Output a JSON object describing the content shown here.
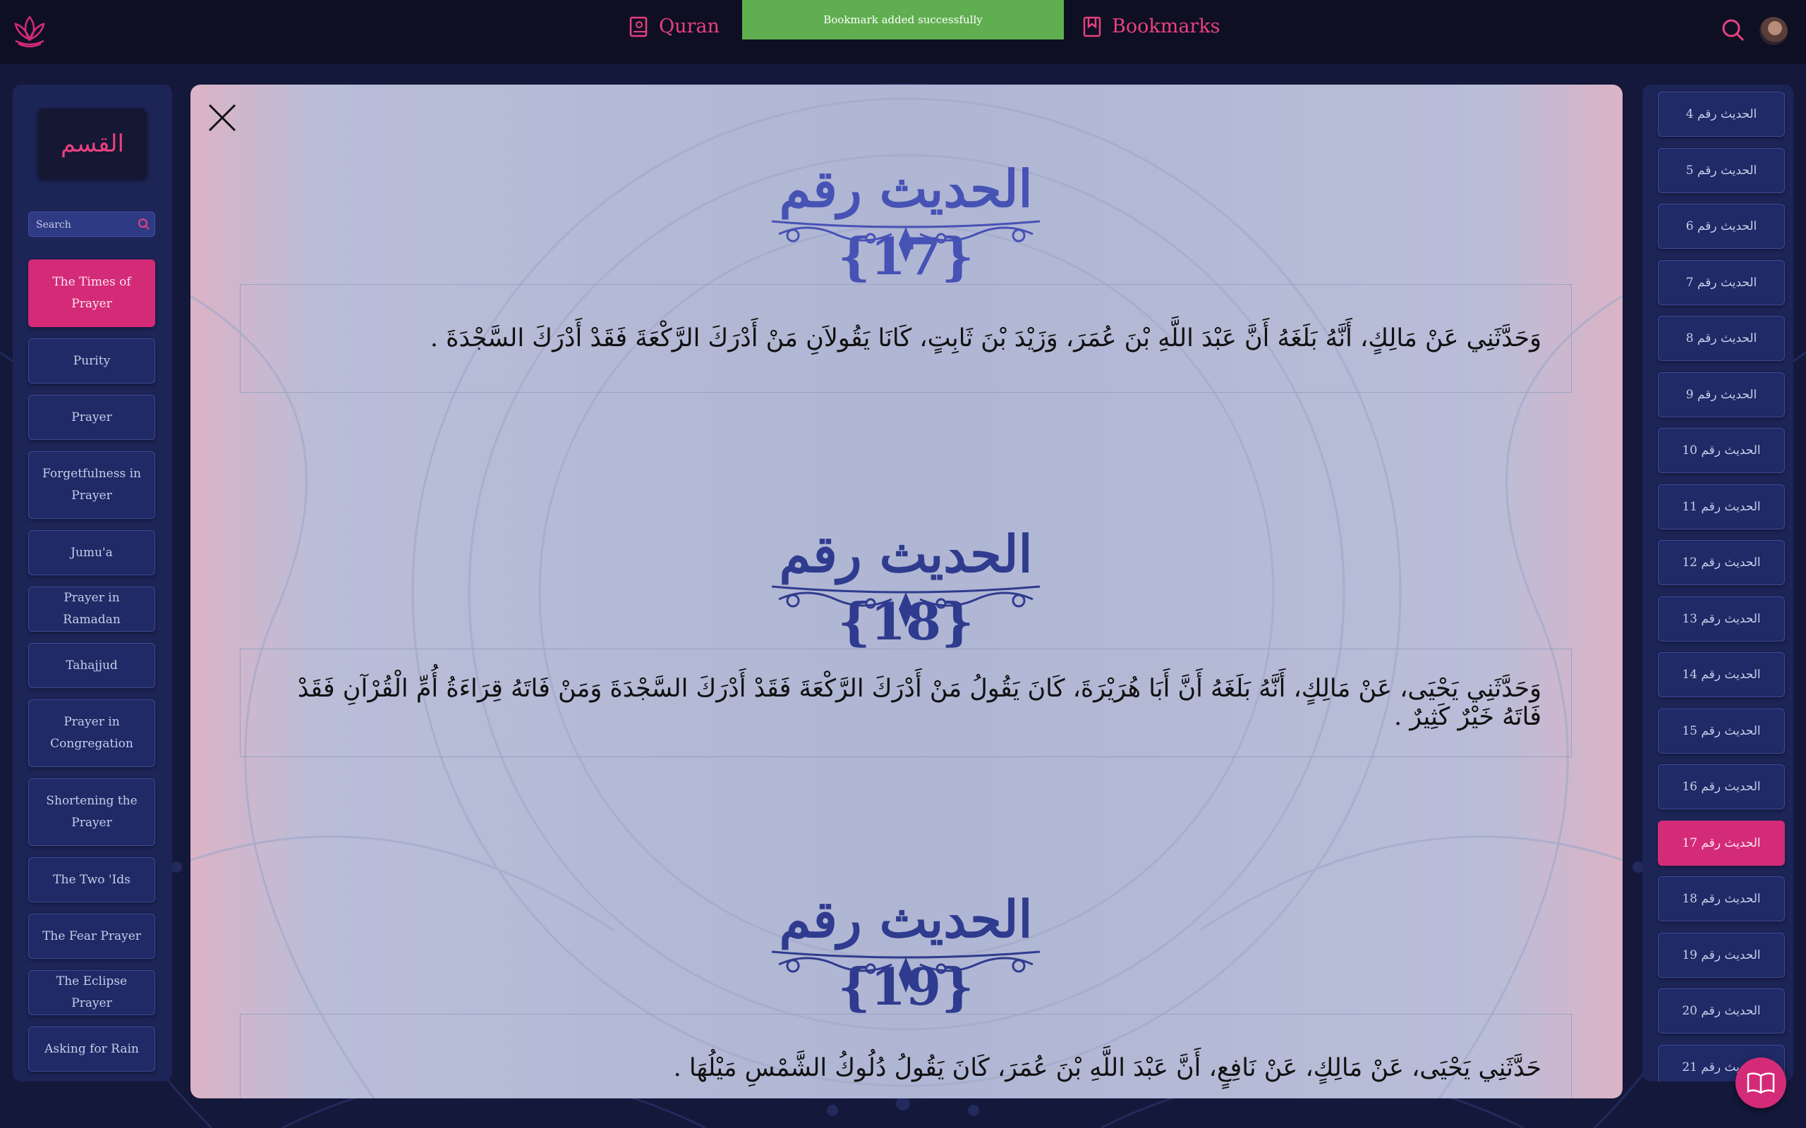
{
  "colors": {
    "accent": "#e8417f",
    "active_item": "#d42b78",
    "toast": "#5fae4f",
    "panel": "#1d2456",
    "topbar": "#0e0f23",
    "title_blue": "#4752b5"
  },
  "header": {
    "nav": [
      {
        "label": "Quran",
        "icon": "quran-book-icon"
      },
      {
        "label": "Bookmarks",
        "icon": "bookmark-icon"
      }
    ],
    "toast": "Bookmark added successfully"
  },
  "sidebar": {
    "section_label": "القسم",
    "search_placeholder": "Search",
    "chapters": [
      {
        "label": "The Times of Prayer",
        "active": true
      },
      {
        "label": "Purity",
        "active": false
      },
      {
        "label": "Prayer",
        "active": false
      },
      {
        "label": "Forgetfulness in Prayer",
        "active": false
      },
      {
        "label": "Jumu'a",
        "active": false
      },
      {
        "label": "Prayer in Ramadan",
        "active": false
      },
      {
        "label": "Tahajjud",
        "active": false
      },
      {
        "label": "Prayer in Congregation",
        "active": false
      },
      {
        "label": "Shortening the Prayer",
        "active": false
      },
      {
        "label": "The Two 'Ids",
        "active": false
      },
      {
        "label": "The Fear Prayer",
        "active": false
      },
      {
        "label": "The Eclipse Prayer",
        "active": false
      },
      {
        "label": "Asking for Rain",
        "active": false
      }
    ]
  },
  "modal": {
    "hadiths": [
      {
        "title": "الحديث رقم {17}",
        "text": "وَحَدَّثَنِي عَنْ مَالِكٍ، أَنَّهُ بَلَغَهُ أَنَّ عَبْدَ اللَّهِ بْنَ عُمَرَ، وَزَيْدَ بْنَ ثَابِتٍ، كَانَا يَقُولاَنِ مَنْ أَدْرَكَ الرَّكْعَةَ فَقَدْ أَدْرَكَ السَّجْدَةَ ."
      },
      {
        "title": "الحديث رقم {18}",
        "text": "وَحَدَّثَنِي يَحْيَى، عَنْ مَالِكٍ، أَنَّهُ بَلَغَهُ أَنَّ أَبَا هُرَيْرَةَ، كَانَ يَقُولُ مَنْ أَدْرَكَ الرَّكْعَةَ فَقَدْ أَدْرَكَ السَّجْدَةَ وَمَنْ فَاتَهُ قِرَاءَةُ أُمِّ الْقُرْآنِ فَقَدْ فَاتَهُ خَيْرٌ كَثِيرٌ ."
      },
      {
        "title": "الحديث رقم {19}",
        "text": "حَدَّثَنِي يَحْيَى، عَنْ مَالِكٍ، عَنْ نَافِعٍ، أَنَّ عَبْدَ اللَّهِ بْنَ عُمَرَ، كَانَ يَقُولُ دُلُوكُ الشَّمْسِ مَيْلُهَا ."
      }
    ]
  },
  "hadith_list": [
    {
      "label": "الحديث رقم 4",
      "active": false
    },
    {
      "label": "الحديث رقم 5",
      "active": false
    },
    {
      "label": "الحديث رقم 6",
      "active": false
    },
    {
      "label": "الحديث رقم 7",
      "active": false
    },
    {
      "label": "الحديث رقم 8",
      "active": false
    },
    {
      "label": "الحديث رقم 9",
      "active": false
    },
    {
      "label": "الحديث رقم 10",
      "active": false
    },
    {
      "label": "الحديث رقم 11",
      "active": false
    },
    {
      "label": "الحديث رقم 12",
      "active": false
    },
    {
      "label": "الحديث رقم 13",
      "active": false
    },
    {
      "label": "الحديث رقم 14",
      "active": false
    },
    {
      "label": "الحديث رقم 15",
      "active": false
    },
    {
      "label": "الحديث رقم 16",
      "active": false
    },
    {
      "label": "الحديث رقم 17",
      "active": true
    },
    {
      "label": "الحديث رقم 18",
      "active": false
    },
    {
      "label": "الحديث رقم 19",
      "active": false
    },
    {
      "label": "الحديث رقم 20",
      "active": false
    },
    {
      "label": "الحديث رقم 21",
      "active": false
    }
  ]
}
